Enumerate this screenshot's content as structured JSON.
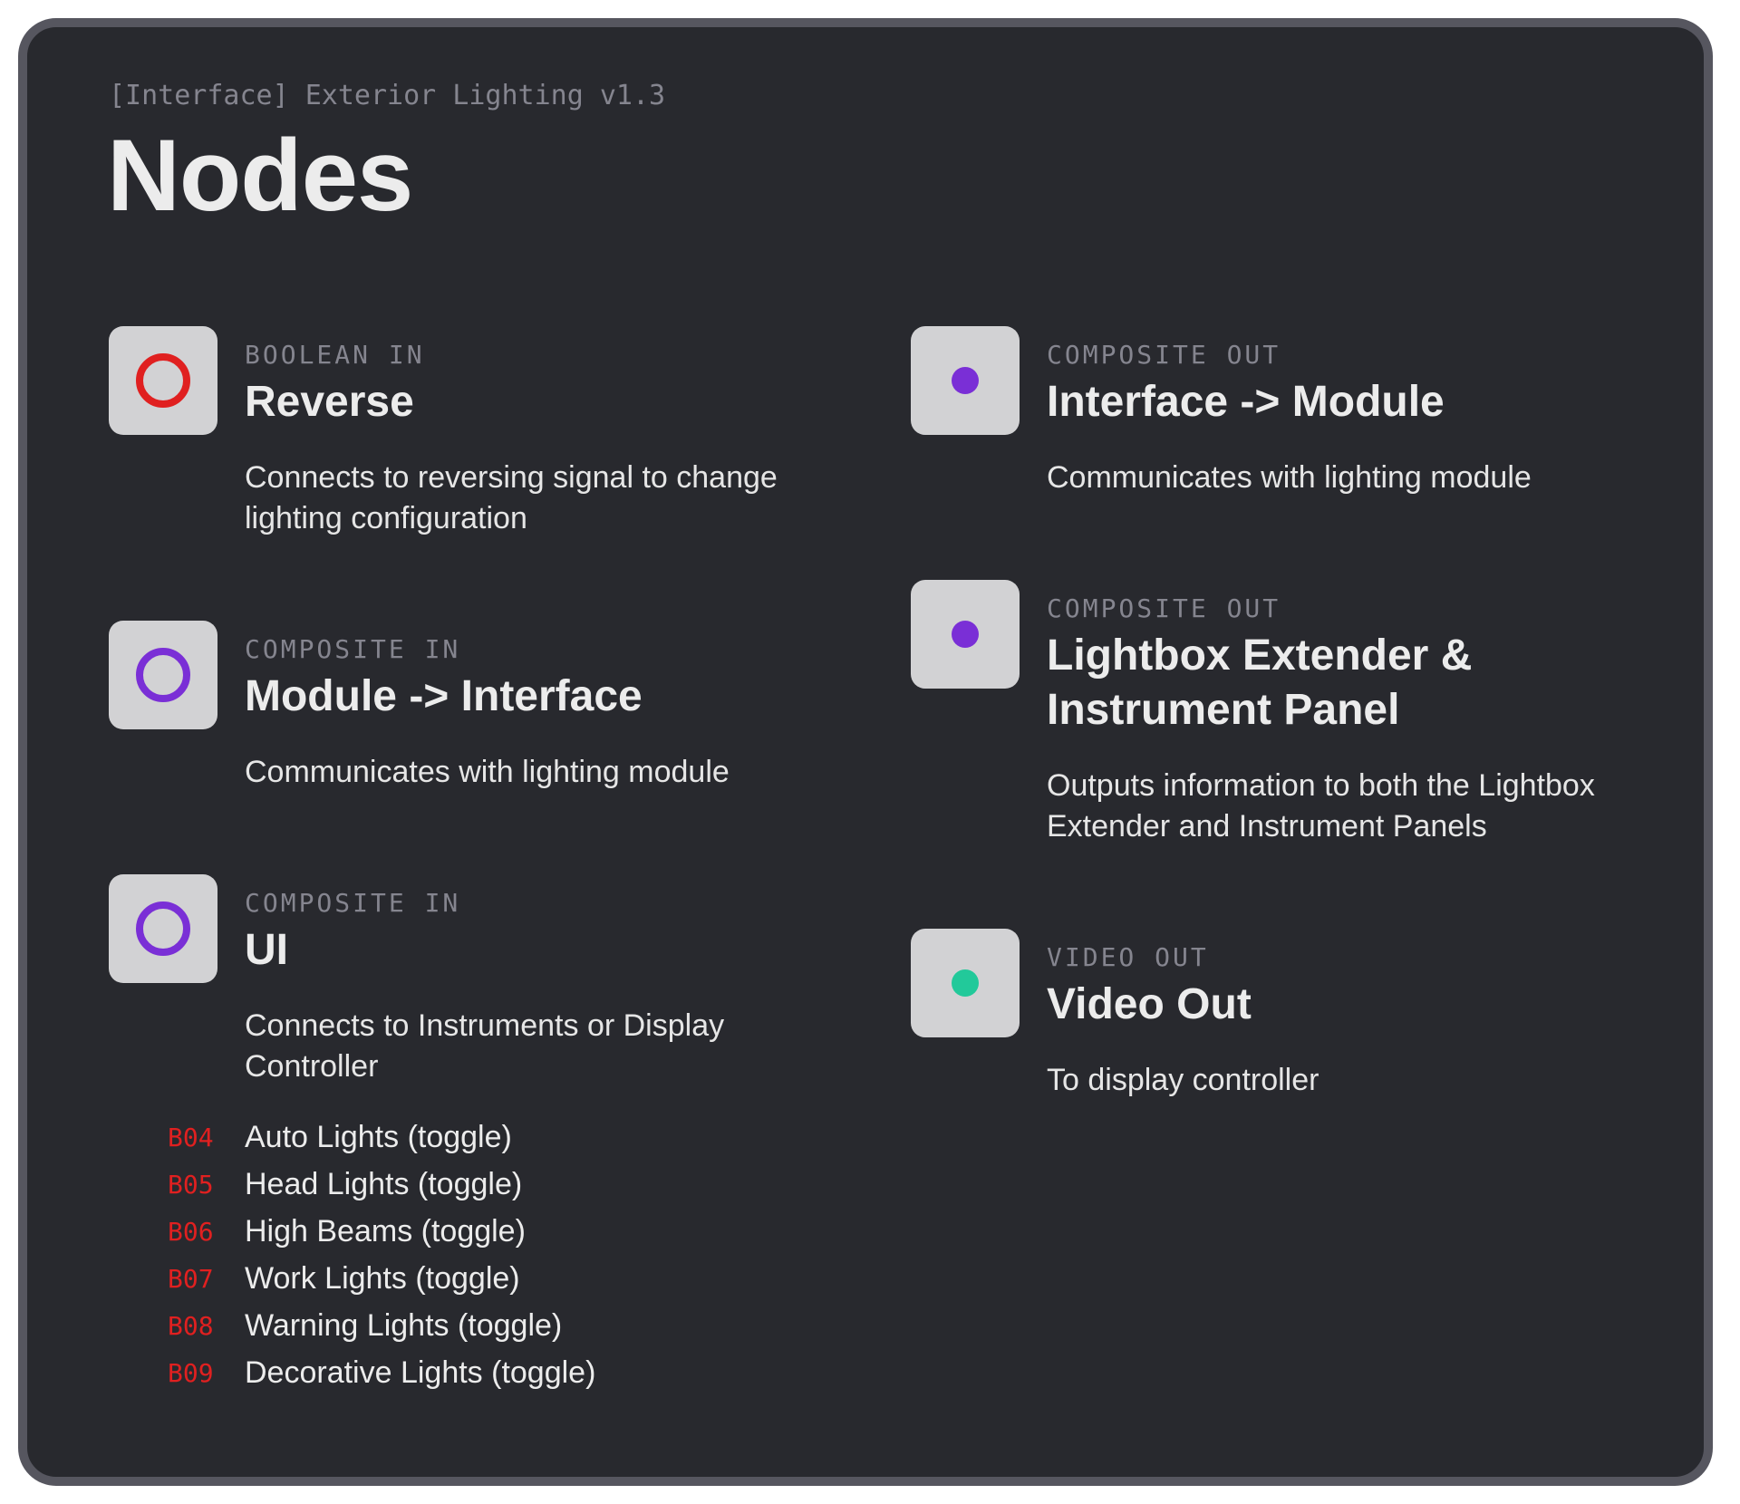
{
  "header": {
    "subtitle": "[Interface] Exterior Lighting v1.3",
    "title": "Nodes"
  },
  "colors": {
    "boolean": "#e02020",
    "composite": "#7a2fd6",
    "video": "#22c99a"
  },
  "nodes_left": [
    {
      "kind": "BOOLEAN IN",
      "name": "Reverse",
      "description": "Connects to reversing signal to change lighting configuration",
      "icon": "red-ring-icon"
    },
    {
      "kind": "COMPOSITE IN",
      "name": "Module -> Interface",
      "description": "Communicates with lighting module",
      "icon": "purple-ring-icon"
    },
    {
      "kind": "COMPOSITE IN",
      "name": "UI",
      "description": "Connects to Instruments or Display Controller",
      "icon": "purple-ring-icon"
    }
  ],
  "nodes_right": [
    {
      "kind": "COMPOSITE OUT",
      "name": "Interface -> Module",
      "description": "Communicates with lighting module",
      "icon": "purple-dot-icon"
    },
    {
      "kind": "COMPOSITE OUT",
      "name": "Lightbox Extender & Instrument Panel",
      "description": "Outputs information to both the Lightbox Extender and Instrument Panels",
      "icon": "purple-dot-icon"
    },
    {
      "kind": "VIDEO OUT",
      "name": "Video Out",
      "description": "To display controller",
      "icon": "green-dot-icon"
    }
  ],
  "ui_bits": [
    {
      "code": "B04",
      "label": "Auto Lights (toggle)"
    },
    {
      "code": "B05",
      "label": "Head Lights (toggle)"
    },
    {
      "code": "B06",
      "label": "High Beams (toggle)"
    },
    {
      "code": "B07",
      "label": "Work Lights (toggle)"
    },
    {
      "code": "B08",
      "label": "Warning Lights (toggle)"
    },
    {
      "code": "B09",
      "label": "Decorative Lights (toggle)"
    }
  ]
}
